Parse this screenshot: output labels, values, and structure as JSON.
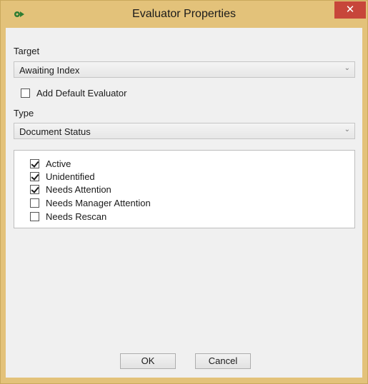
{
  "window": {
    "title": "Evaluator Properties",
    "close_icon": "close-icon",
    "app_icon": "gear-arrow-icon",
    "accent_color": "#e3c27a"
  },
  "target": {
    "label": "Target",
    "value": "Awaiting Index"
  },
  "default_evaluator": {
    "label": "Add Default Evaluator",
    "checked": false
  },
  "type": {
    "label": "Type",
    "value": "Document Status"
  },
  "statuses": [
    {
      "label": "Active",
      "checked": true
    },
    {
      "label": "Unidentified",
      "checked": true
    },
    {
      "label": "Needs Attention",
      "checked": true
    },
    {
      "label": "Needs Manager Attention",
      "checked": false
    },
    {
      "label": "Needs Rescan",
      "checked": false
    }
  ],
  "buttons": {
    "ok": "OK",
    "cancel": "Cancel"
  }
}
